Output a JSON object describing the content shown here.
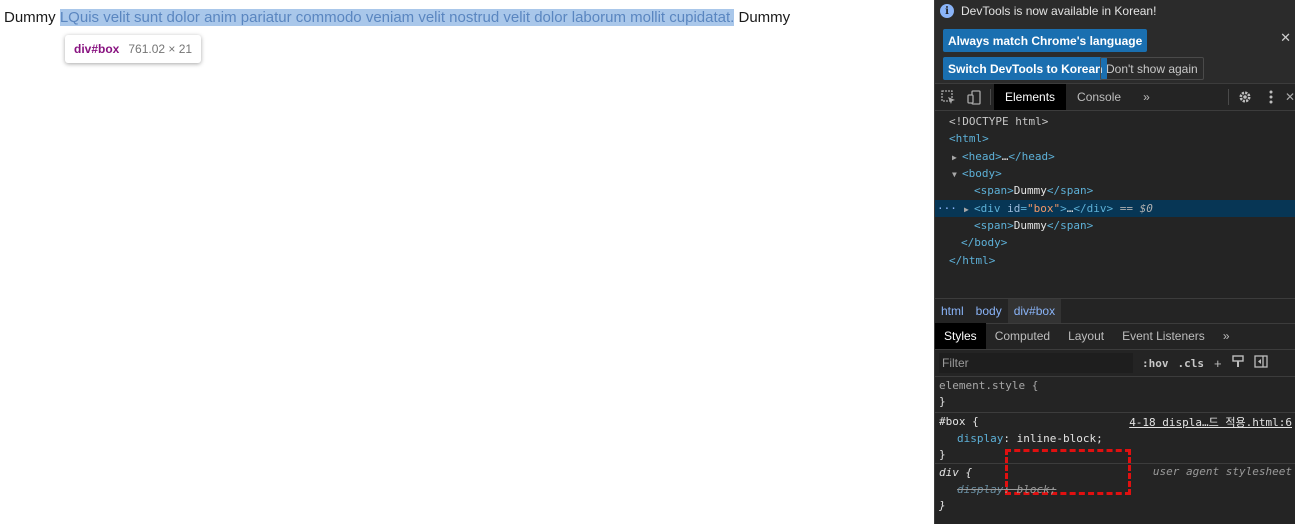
{
  "page": {
    "span_before": "Dummy",
    "box_text": "LQuis velit sunt dolor anim pariatur commodo veniam velit nostrud velit dolor laborum mollit cupidatat.",
    "span_after": "Dummy",
    "tooltip_tag": "div#box",
    "tooltip_dims": "761.02 × 21"
  },
  "infobar": {
    "message": "DevTools is now available in Korean!",
    "btn_match": "Always match Chrome's language",
    "btn_switch": "Switch DevTools to Korean",
    "btn_dont_show": "Don't show again"
  },
  "toolbar": {
    "tabs": [
      "Elements",
      "Console"
    ],
    "active_tab": "Elements",
    "more": "»"
  },
  "dom": {
    "doctype": "<!DOCTYPE html>",
    "html_open": "<html>",
    "head": "<head>",
    "head_ellipsis": "…",
    "head_close": "</head>",
    "body_open": "<body>",
    "span_open": "<span>",
    "span_text": "Dummy",
    "span_close": "</span>",
    "div_open": "<div ",
    "div_attr": "id",
    "div_val": "\"box\"",
    "div_gt": ">",
    "div_ellipsis": "…",
    "div_close": "</div>",
    "selected_marker": "== $0",
    "body_close": "</body>",
    "html_close": "</html>"
  },
  "breadcrumbs": [
    "html",
    "body",
    "div#box"
  ],
  "subtabs": [
    "Styles",
    "Computed",
    "Layout",
    "Event Listeners"
  ],
  "filter": {
    "placeholder": "Filter",
    "hov": ":hov",
    "cls": ".cls"
  },
  "styles": {
    "element_style": "element.style {",
    "element_style_close": "}",
    "box_selector": "#box {",
    "box_source": "4-18 displa…드 적용.html:6",
    "box_prop": "display",
    "box_value": "inline-block;",
    "box_close": "}",
    "div_selector": "div {",
    "div_source": "user agent stylesheet",
    "div_prop": "display",
    "div_value": "block;",
    "div_close": "}"
  }
}
